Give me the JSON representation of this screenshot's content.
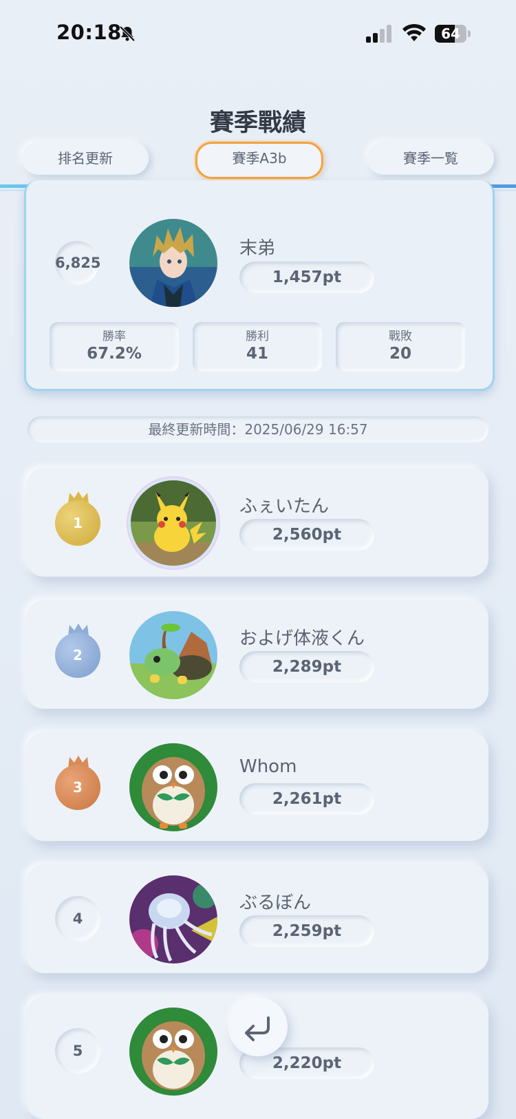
{
  "status_bar": {
    "time": "20:18",
    "battery": "64",
    "battery_level": 0.64
  },
  "header": {
    "title": "賽季戰績",
    "tabs": [
      "排名更新",
      "賽季A3b",
      "賽季一覧"
    ]
  },
  "my_card": {
    "rank": "6,825",
    "name": "末弟",
    "points": "1,457pt",
    "stats": [
      {
        "label": "勝率",
        "value": "67.2%"
      },
      {
        "label": "勝利",
        "value": "41"
      },
      {
        "label": "戰敗",
        "value": "20"
      }
    ]
  },
  "last_updated": "最終更新時間：2025/06/29 16:57",
  "ranking": [
    {
      "rank": "1",
      "name": "ふぇいたん",
      "points": "2,560pt"
    },
    {
      "rank": "2",
      "name": "およげ体液くん",
      "points": "2,289pt"
    },
    {
      "rank": "3",
      "name": "Whom",
      "points": "2,261pt"
    },
    {
      "rank": "4",
      "name": "ぶるぼん",
      "points": "2,259pt"
    },
    {
      "rank": "5",
      "name": "",
      "points": "2,220pt"
    }
  ],
  "colors": {
    "accent_orange": "#f0a24a",
    "accent_blue": "#5aa7e0",
    "gold": "#d9b84a",
    "silver_blue": "#8eadd8",
    "bronze": "#d98a57"
  }
}
